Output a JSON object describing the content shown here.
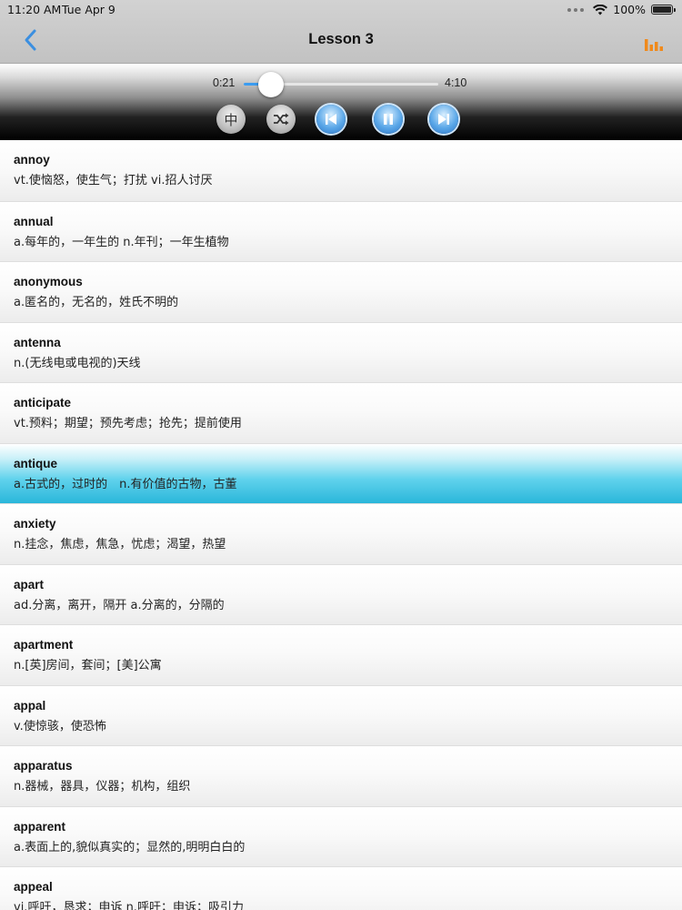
{
  "status": {
    "time": "11:20 AM",
    "date": "Tue Apr 9",
    "battery": "100%"
  },
  "nav": {
    "title": "Lesson 3",
    "back_icon": "chevron-left-icon",
    "stats_icon": "bar-chart-icon",
    "accent_color": "#3b8fe0",
    "stats_color": "#f08a1c"
  },
  "player": {
    "current_time": "0:21",
    "total_time": "4:10",
    "progress": 0.14,
    "chinese_toggle_label": "中",
    "buttons": [
      "chinese-toggle",
      "shuffle",
      "previous",
      "pause",
      "next"
    ]
  },
  "words": [
    {
      "word": "annoy",
      "definition": "vt.使恼怒，使生气；打扰 vi.招人讨厌"
    },
    {
      "word": "annual",
      "definition": "a.每年的，一年生的 n.年刊；一年生植物"
    },
    {
      "word": "anonymous",
      "definition": "a.匿名的，无名的，姓氏不明的"
    },
    {
      "word": "antenna",
      "definition": "n.(无线电或电视的)天线"
    },
    {
      "word": "anticipate",
      "definition": "vt.预料；期望；预先考虑；抢先；提前使用"
    },
    {
      "word": "antique",
      "definition": "a.古式的，过时的　n.有价值的古物，古董",
      "selected": true
    },
    {
      "word": "anxiety",
      "definition": "n.挂念，焦虑，焦急，忧虑；渴望，热望"
    },
    {
      "word": "apart",
      "definition": "ad.分离，离开，隔开 a.分离的，分隔的"
    },
    {
      "word": "apartment",
      "definition": "n.[英]房间，套间；[美]公寓"
    },
    {
      "word": "appal",
      "definition": "v.使惊骇，使恐怖"
    },
    {
      "word": "apparatus",
      "definition": "n.器械，器具，仪器；机构，组织"
    },
    {
      "word": "apparent",
      "definition": "a.表面上的,貌似真实的；显然的,明明白白的"
    },
    {
      "word": "appeal",
      "definition": "vi.呼吁，恳求；申诉 n.呼吁；申诉；吸引力"
    }
  ]
}
